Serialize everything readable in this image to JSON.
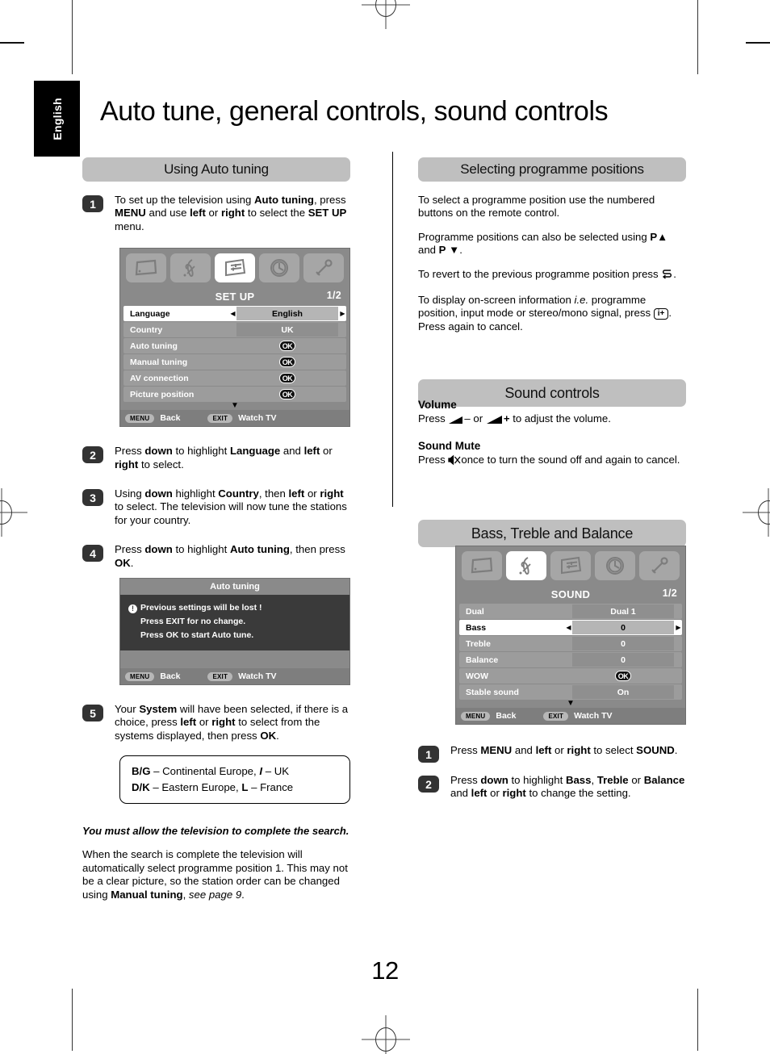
{
  "meta": {
    "language_tab": "English",
    "page_number": "12"
  },
  "header": {
    "title": "Auto tune, general controls, sound controls"
  },
  "sections": {
    "using_auto_tuning": "Using Auto tuning",
    "selecting_programme_positions": "Selecting programme positions",
    "sound_controls": "Sound controls",
    "bass_treble_balance": "Bass, Treble and Balance"
  },
  "auto_tuning_steps": [
    {
      "num": "1",
      "html": "To set up the television using <b>Auto tuning</b>, press <b>MENU</b> and use <b>left</b> or <b>right</b> to select the <b>SET UP</b> menu."
    },
    {
      "num": "2",
      "html": "Press <b>down</b> to highlight <b>Language</b> and <b>left</b> or <b>right</b> to select."
    },
    {
      "num": "3",
      "html": "Using <b>down</b> highlight <b>Country</b>, then <b>left</b> or <b>right</b> to select. The television will now tune the stations for your country."
    },
    {
      "num": "4",
      "html": "Press <b>down</b> to highlight <b>Auto tuning</b>, then press <b>OK</b>."
    },
    {
      "num": "5",
      "html": "Your <b>System</b> will have been selected, if there is a choice, press <b>left</b> or <b>right</b> to select from the systems displayed, then press <b>OK</b>."
    }
  ],
  "setup_menu": {
    "title": "SET UP",
    "page_indicator": "1/2",
    "icons": [
      "picture-icon",
      "sound-icon",
      "setup-icon",
      "clock-icon",
      "tools-icon"
    ],
    "active_icon_index": 2,
    "rows": [
      {
        "label": "Language",
        "value": "English",
        "selected": true,
        "arrows": true,
        "ok": false
      },
      {
        "label": "Country",
        "value": "UK",
        "selected": false,
        "arrows": false,
        "ok": false
      },
      {
        "label": "Auto tuning",
        "value": "OK",
        "selected": false,
        "arrows": false,
        "ok": true
      },
      {
        "label": "Manual tuning",
        "value": "OK",
        "selected": false,
        "arrows": false,
        "ok": true
      },
      {
        "label": "AV connection",
        "value": "OK",
        "selected": false,
        "arrows": false,
        "ok": true
      },
      {
        "label": "Picture position",
        "value": "OK",
        "selected": false,
        "arrows": false,
        "ok": true
      }
    ],
    "footer": {
      "menu_key": "MENU",
      "menu_action": "Back",
      "exit_key": "EXIT",
      "exit_action": "Watch TV"
    }
  },
  "auto_tuning_dialog": {
    "title": "Auto tuning",
    "lines": [
      "Previous settings will be lost  !",
      "Press EXIT for no change.",
      "Press OK to start Auto tune."
    ],
    "footer": {
      "menu_key": "MENU",
      "menu_action": "Back",
      "exit_key": "EXIT",
      "exit_action": "Watch TV"
    }
  },
  "system_box": {
    "line1_html": "<b>B/G</b> &ndash; Continental Europe, <b><i>I</i></b> &ndash; UK",
    "line2_html": "<b>D/K</b> &ndash; Eastern Europe, <b>L</b> &ndash; France"
  },
  "left_notes": {
    "bold_italic": "You must allow the television to complete the search.",
    "paragraph_html": "When the search is complete the television will automatically select programme position 1. This may not be a clear picture, so the station order can be changed using <b>Manual tuning</b>, <i>see page 9</i>."
  },
  "programme_positions": {
    "p1_html": "To select a programme position use the numbered buttons on the remote control.",
    "p2_html": "Programme positions can also be selected using <b>P&#9650;</b> and <b>P&nbsp;&#9660;</b>.",
    "p3_prefix": "To revert to the previous programme position press",
    "p3_icon": "return-icon",
    "p3_suffix": ".",
    "p4_prefix_html": "To display on-screen information <i>i.e.</i> programme position, input mode or stereo/mono signal, press",
    "p4_key": "i+",
    "p4_suffix_html": ". Press again to cancel."
  },
  "sound": {
    "volume_heading": "Volume",
    "volume_prefix": "Press",
    "volume_minus": "–",
    "volume_or": "or",
    "volume_plus": "+",
    "volume_suffix": "to adjust the volume.",
    "mute_heading": "Sound Mute",
    "mute_prefix": "Press",
    "mute_icon": "mute-icon",
    "mute_suffix": "once to turn the sound off and again to cancel."
  },
  "sound_menu": {
    "title": "SOUND",
    "page_indicator": "1/2",
    "icons": [
      "picture-icon",
      "sound-icon",
      "setup-icon",
      "clock-icon",
      "tools-icon"
    ],
    "active_icon_index": 1,
    "rows": [
      {
        "label": "Dual",
        "value": "Dual 1",
        "selected": false,
        "arrows": false,
        "ok": false
      },
      {
        "label": "Bass",
        "value": "0",
        "selected": true,
        "arrows": true,
        "ok": false
      },
      {
        "label": "Treble",
        "value": "0",
        "selected": false,
        "arrows": false,
        "ok": false
      },
      {
        "label": "Balance",
        "value": "0",
        "selected": false,
        "arrows": false,
        "ok": false
      },
      {
        "label": "WOW",
        "value": "OK",
        "selected": false,
        "arrows": false,
        "ok": true
      },
      {
        "label": "Stable sound",
        "value": "On",
        "selected": false,
        "arrows": false,
        "ok": false
      }
    ],
    "footer": {
      "menu_key": "MENU",
      "menu_action": "Back",
      "exit_key": "EXIT",
      "exit_action": "Watch TV"
    }
  },
  "bass_steps": [
    {
      "num": "1",
      "html": "Press <b>MENU</b> and <b>left</b> or <b>right</b> to select <b>SOUND</b>."
    },
    {
      "num": "2",
      "html": "Press <b>down</b> to highlight <b>Bass</b>, <b>Treble</b> or <b>Balance</b> and <b>left</b> or <b>right</b> to change the setting."
    }
  ],
  "colors": {
    "section_bar": "#bfbfbf",
    "osd_background": "#8a8a8a",
    "osd_row": "#9c9c9c",
    "dialog_body": "#3a3a3a"
  }
}
